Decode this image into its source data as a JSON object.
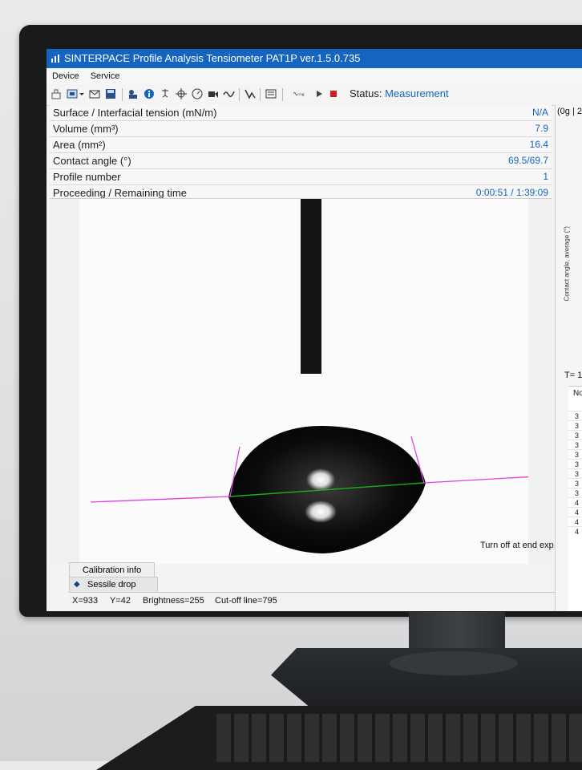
{
  "window": {
    "title": "SINTERPACE Profile Analysis Tensiometer PAT1P   ver.1.5.0.735"
  },
  "menu": [
    "Device",
    "Service"
  ],
  "toolbar": {
    "status_label": "Status:",
    "status_value": "Measurement"
  },
  "parameters": [
    {
      "label": "Surface / Interfacial tension (mN/m)",
      "value": "N/A"
    },
    {
      "label": "Volume (mm³)",
      "value": "7.9"
    },
    {
      "label": "Area (mm²)",
      "value": "16.4"
    },
    {
      "label": "Contact angle (°)",
      "value": "69.5/69.7"
    },
    {
      "label": "Profile number",
      "value": "1"
    },
    {
      "label": "Proceeding / Remaining time",
      "value": "0:00:51 / 1:39:09"
    }
  ],
  "image_panel": {
    "turn_off_label": "Turn off at end exp.",
    "turn_off_checked": false
  },
  "tabs": {
    "calibration_info": "Calibration info",
    "sessile_drop": "Sessile drop"
  },
  "statusbar": {
    "x": "X=933",
    "y": "Y=42",
    "brightness": "Brightness=255",
    "cutoff": "Cut-off line=795"
  },
  "right_panel": {
    "top_text": "(0g | 2",
    "axis_label": "Contact angle, average (°)",
    "temp_text": "T= 1",
    "col_header": "No",
    "rows": [
      "3",
      "3",
      "3",
      "3",
      "3",
      "3",
      "3",
      "3",
      "3",
      "4",
      "4",
      "4",
      "4"
    ]
  },
  "colors": {
    "accent": "#1565c0",
    "baseline": "#e040e0",
    "contact_line": "#1bb01b"
  }
}
